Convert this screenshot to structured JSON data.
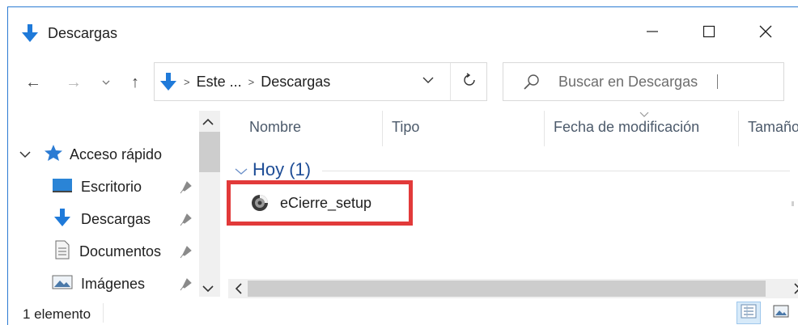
{
  "window": {
    "title": "Descargas",
    "minimize_icon": "minimize-icon",
    "maximize_icon": "maximize-icon",
    "close_icon": "close-icon"
  },
  "nav": {
    "back_glyph": "←",
    "forward_glyph": "→",
    "history_glyph": "⌄",
    "up_glyph": "↑"
  },
  "address": {
    "segments": [
      "Este ...",
      "Descargas"
    ],
    "separator": ">"
  },
  "search": {
    "placeholder": "Buscar en Descargas"
  },
  "nav_pane": {
    "quick_access_label": "Acceso rápido",
    "items": [
      {
        "label": "Escritorio",
        "icon": "desktop-icon",
        "pinned": true
      },
      {
        "label": "Descargas",
        "icon": "download-arrow-icon",
        "pinned": true
      },
      {
        "label": "Documentos",
        "icon": "documents-icon",
        "pinned": true
      },
      {
        "label": "Imágenes",
        "icon": "pictures-icon",
        "pinned": true
      }
    ]
  },
  "columns": [
    "Nombre",
    "Tipo",
    "Fecha de modificación",
    "Tamaño"
  ],
  "group": {
    "label": "Hoy (1)"
  },
  "files": [
    {
      "name": "eCierre_setup",
      "icon": "installer-icon"
    }
  ],
  "status": {
    "text": "1 elemento"
  },
  "colors": {
    "accent": "#2b7bd3",
    "group_text": "#1e4d96",
    "highlight": "#e23a3a",
    "download_blue": "#1f7ad9"
  }
}
